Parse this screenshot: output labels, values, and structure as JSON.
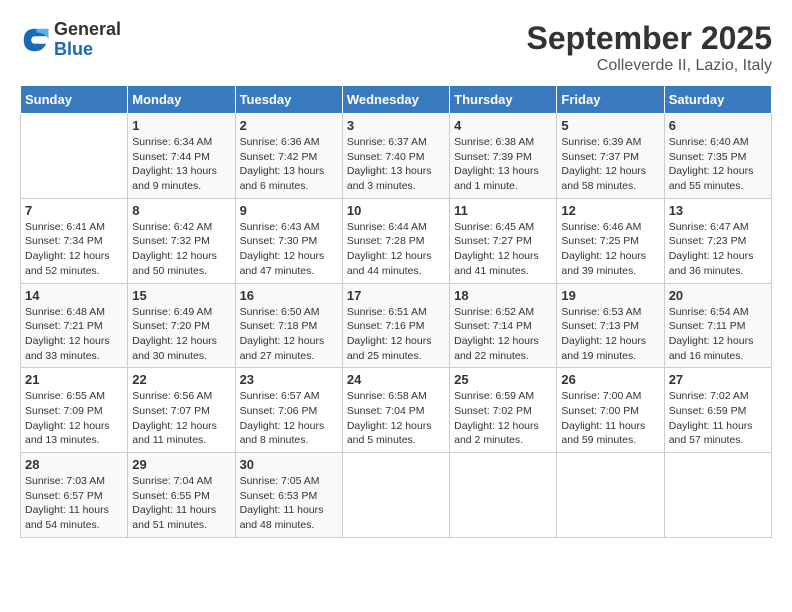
{
  "header": {
    "logo": {
      "general": "General",
      "blue": "Blue"
    },
    "title": "September 2025",
    "location": "Colleverde II, Lazio, Italy"
  },
  "weekdays": [
    "Sunday",
    "Monday",
    "Tuesday",
    "Wednesday",
    "Thursday",
    "Friday",
    "Saturday"
  ],
  "weeks": [
    [
      {
        "day": "",
        "info": ""
      },
      {
        "day": "1",
        "info": "Sunrise: 6:34 AM\nSunset: 7:44 PM\nDaylight: 13 hours\nand 9 minutes."
      },
      {
        "day": "2",
        "info": "Sunrise: 6:36 AM\nSunset: 7:42 PM\nDaylight: 13 hours\nand 6 minutes."
      },
      {
        "day": "3",
        "info": "Sunrise: 6:37 AM\nSunset: 7:40 PM\nDaylight: 13 hours\nand 3 minutes."
      },
      {
        "day": "4",
        "info": "Sunrise: 6:38 AM\nSunset: 7:39 PM\nDaylight: 13 hours\nand 1 minute."
      },
      {
        "day": "5",
        "info": "Sunrise: 6:39 AM\nSunset: 7:37 PM\nDaylight: 12 hours\nand 58 minutes."
      },
      {
        "day": "6",
        "info": "Sunrise: 6:40 AM\nSunset: 7:35 PM\nDaylight: 12 hours\nand 55 minutes."
      }
    ],
    [
      {
        "day": "7",
        "info": "Sunrise: 6:41 AM\nSunset: 7:34 PM\nDaylight: 12 hours\nand 52 minutes."
      },
      {
        "day": "8",
        "info": "Sunrise: 6:42 AM\nSunset: 7:32 PM\nDaylight: 12 hours\nand 50 minutes."
      },
      {
        "day": "9",
        "info": "Sunrise: 6:43 AM\nSunset: 7:30 PM\nDaylight: 12 hours\nand 47 minutes."
      },
      {
        "day": "10",
        "info": "Sunrise: 6:44 AM\nSunset: 7:28 PM\nDaylight: 12 hours\nand 44 minutes."
      },
      {
        "day": "11",
        "info": "Sunrise: 6:45 AM\nSunset: 7:27 PM\nDaylight: 12 hours\nand 41 minutes."
      },
      {
        "day": "12",
        "info": "Sunrise: 6:46 AM\nSunset: 7:25 PM\nDaylight: 12 hours\nand 39 minutes."
      },
      {
        "day": "13",
        "info": "Sunrise: 6:47 AM\nSunset: 7:23 PM\nDaylight: 12 hours\nand 36 minutes."
      }
    ],
    [
      {
        "day": "14",
        "info": "Sunrise: 6:48 AM\nSunset: 7:21 PM\nDaylight: 12 hours\nand 33 minutes."
      },
      {
        "day": "15",
        "info": "Sunrise: 6:49 AM\nSunset: 7:20 PM\nDaylight: 12 hours\nand 30 minutes."
      },
      {
        "day": "16",
        "info": "Sunrise: 6:50 AM\nSunset: 7:18 PM\nDaylight: 12 hours\nand 27 minutes."
      },
      {
        "day": "17",
        "info": "Sunrise: 6:51 AM\nSunset: 7:16 PM\nDaylight: 12 hours\nand 25 minutes."
      },
      {
        "day": "18",
        "info": "Sunrise: 6:52 AM\nSunset: 7:14 PM\nDaylight: 12 hours\nand 22 minutes."
      },
      {
        "day": "19",
        "info": "Sunrise: 6:53 AM\nSunset: 7:13 PM\nDaylight: 12 hours\nand 19 minutes."
      },
      {
        "day": "20",
        "info": "Sunrise: 6:54 AM\nSunset: 7:11 PM\nDaylight: 12 hours\nand 16 minutes."
      }
    ],
    [
      {
        "day": "21",
        "info": "Sunrise: 6:55 AM\nSunset: 7:09 PM\nDaylight: 12 hours\nand 13 minutes."
      },
      {
        "day": "22",
        "info": "Sunrise: 6:56 AM\nSunset: 7:07 PM\nDaylight: 12 hours\nand 11 minutes."
      },
      {
        "day": "23",
        "info": "Sunrise: 6:57 AM\nSunset: 7:06 PM\nDaylight: 12 hours\nand 8 minutes."
      },
      {
        "day": "24",
        "info": "Sunrise: 6:58 AM\nSunset: 7:04 PM\nDaylight: 12 hours\nand 5 minutes."
      },
      {
        "day": "25",
        "info": "Sunrise: 6:59 AM\nSunset: 7:02 PM\nDaylight: 12 hours\nand 2 minutes."
      },
      {
        "day": "26",
        "info": "Sunrise: 7:00 AM\nSunset: 7:00 PM\nDaylight: 11 hours\nand 59 minutes."
      },
      {
        "day": "27",
        "info": "Sunrise: 7:02 AM\nSunset: 6:59 PM\nDaylight: 11 hours\nand 57 minutes."
      }
    ],
    [
      {
        "day": "28",
        "info": "Sunrise: 7:03 AM\nSunset: 6:57 PM\nDaylight: 11 hours\nand 54 minutes."
      },
      {
        "day": "29",
        "info": "Sunrise: 7:04 AM\nSunset: 6:55 PM\nDaylight: 11 hours\nand 51 minutes."
      },
      {
        "day": "30",
        "info": "Sunrise: 7:05 AM\nSunset: 6:53 PM\nDaylight: 11 hours\nand 48 minutes."
      },
      {
        "day": "",
        "info": ""
      },
      {
        "day": "",
        "info": ""
      },
      {
        "day": "",
        "info": ""
      },
      {
        "day": "",
        "info": ""
      }
    ]
  ]
}
